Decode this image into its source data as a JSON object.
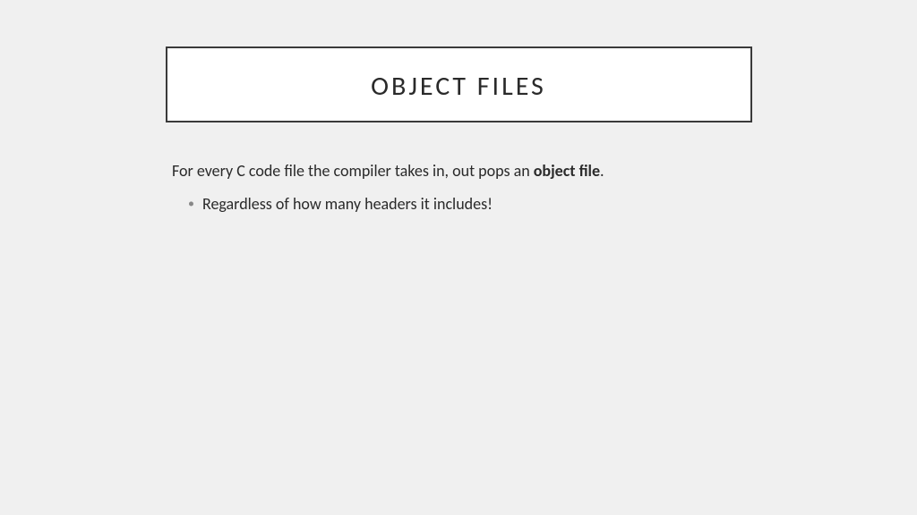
{
  "slide": {
    "title": "OBJECT FILES",
    "lead_pre": "For every C code file the compiler takes in, out pops an ",
    "lead_bold": "object file",
    "lead_post": ".",
    "bullets": {
      "0": "Regardless of how many headers it includes!"
    }
  }
}
